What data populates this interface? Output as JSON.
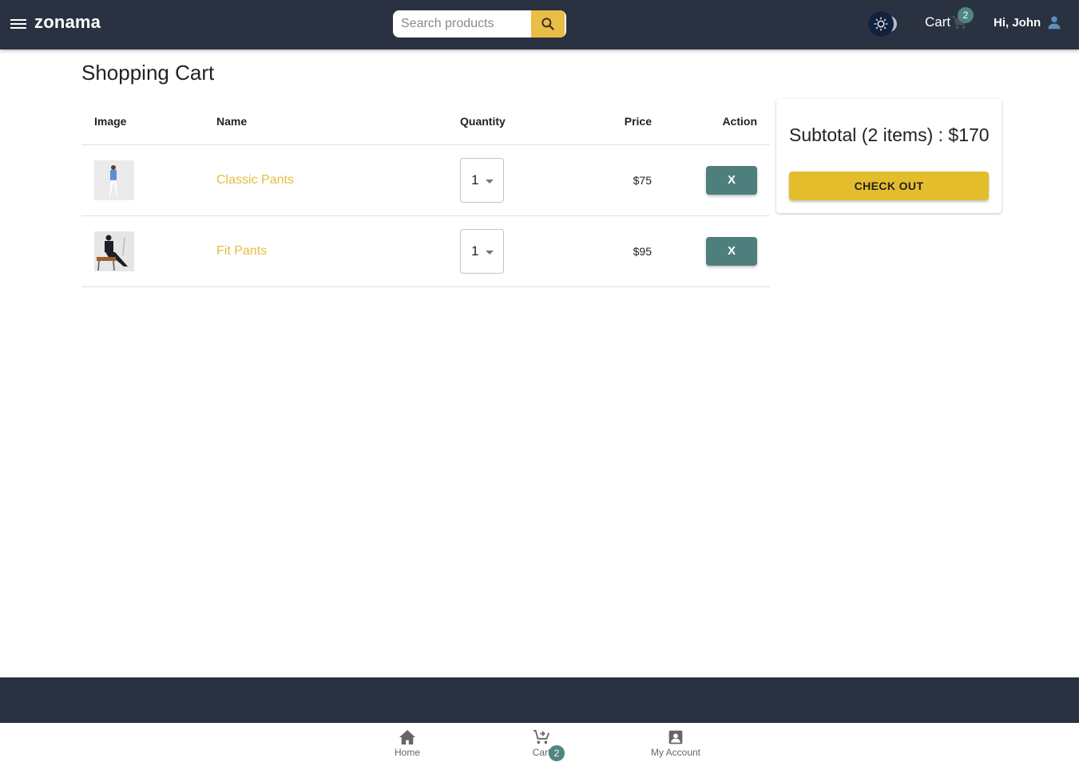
{
  "header": {
    "brand": "zonama",
    "search": {
      "placeholder": "Search products",
      "value": ""
    },
    "cart_label": "Cart",
    "cart_count": "2",
    "greeting": "Hi, John",
    "theme_mode": "light"
  },
  "page": {
    "title": "Shopping Cart"
  },
  "table": {
    "columns": [
      "Image",
      "Name",
      "Quantity",
      "Price",
      "Action"
    ],
    "rows": [
      {
        "name": "Classic Pants",
        "quantity": "1",
        "price": "$75",
        "action": "X",
        "image": "man in blue shirt and white pants"
      },
      {
        "name": "Fit Pants",
        "quantity": "1",
        "price": "$95",
        "action": "X",
        "image": "man in black outfit seated on bench"
      }
    ]
  },
  "summary": {
    "subtotal": "Subtotal (2 items) : $170",
    "checkout_label": "CHECK OUT"
  },
  "bottom_nav": {
    "items": [
      {
        "label": "Home",
        "icon": "home-icon"
      },
      {
        "label": "Cart",
        "icon": "add-shopping-cart-icon",
        "badge": "2"
      },
      {
        "label": "My Account",
        "icon": "account-box-icon"
      }
    ]
  },
  "colors": {
    "appbar": "#2a3241",
    "accent_yellow": "#e4bd2c",
    "teal": "#4f7f7c",
    "link": "#e4be3b"
  }
}
